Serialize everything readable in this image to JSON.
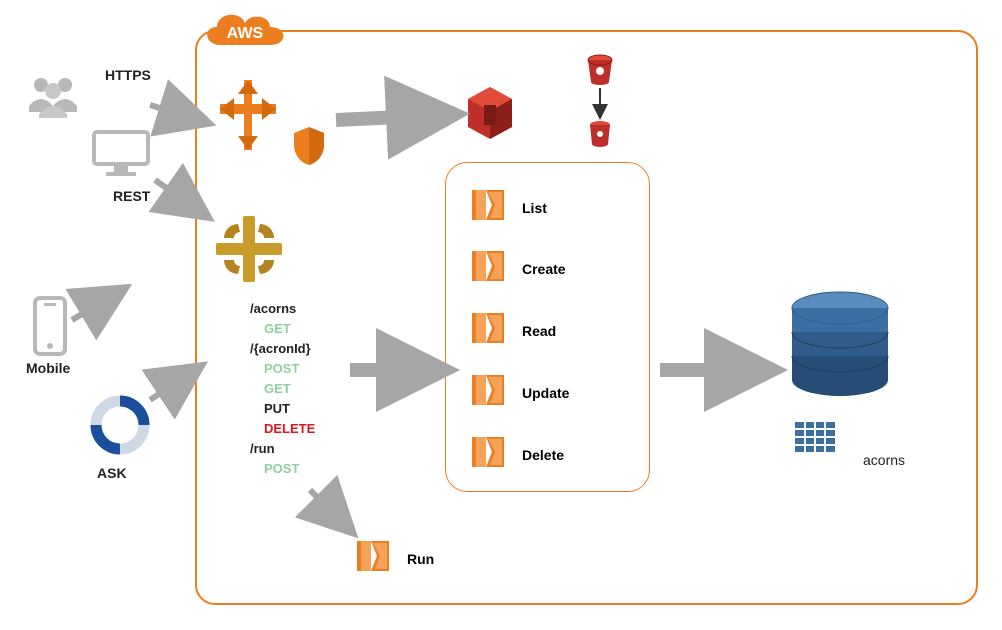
{
  "cloud_label": "AWS",
  "clients": {
    "https": "HTTPS",
    "rest": "REST",
    "mobile": "Mobile",
    "ask": "ASK"
  },
  "routes": {
    "root": "/acorns",
    "root_method": "GET",
    "id": "/{acronId}",
    "id_post": "POST",
    "id_get": "GET",
    "id_put": "PUT",
    "id_delete": "DELETE",
    "run": "/run",
    "run_post": "POST"
  },
  "lambdas": {
    "list": "List",
    "create": "Create",
    "read": "Read",
    "update": "Update",
    "delete": "Delete",
    "run": "Run"
  },
  "storage": {
    "table": "acorns"
  },
  "icons": {
    "users": "users-icon",
    "desktop": "desktop-icon",
    "mobile": "mobile-phone-icon",
    "ask": "alexa-ring-icon",
    "cognito": "aws-cognito-icon",
    "shield": "aws-waf-shield-icon",
    "apigw": "aws-api-gateway-icon",
    "s3": "aws-s3-icon",
    "bucket": "aws-s3-bucket-icon",
    "lambda": "aws-lambda-icon",
    "dynamodb": "aws-dynamodb-icon",
    "db_table": "db-table-icon"
  },
  "colors": {
    "aws_orange": "#ed7e20",
    "apigw_gold": "#c89b2a",
    "s3_red": "#bf2f2a",
    "db_blue": "#3b6fa3",
    "grey": "#a6a6a6"
  }
}
